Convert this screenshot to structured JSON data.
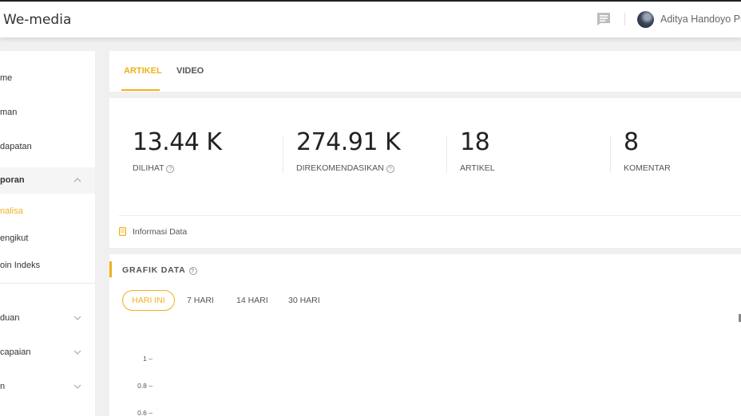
{
  "header": {
    "brand": "We-media",
    "message_icon": "message-icon",
    "user_name": "Aditya Handoyo Pr"
  },
  "sidebar": {
    "items": [
      {
        "label": "me",
        "chevron": null
      },
      {
        "label": "man",
        "chevron": null
      },
      {
        "label": "dapatan",
        "chevron": null
      },
      {
        "label": "poran",
        "chevron": "chevron-up-icon",
        "expanded": true
      },
      {
        "label": "nalisa",
        "chevron": null,
        "current": true
      },
      {
        "label": "engikut",
        "chevron": null
      },
      {
        "label": "oin Indeks",
        "chevron": null
      },
      {
        "label": "duan",
        "chevron": "chevron-down-icon"
      },
      {
        "label": "capaian",
        "chevron": "chevron-down-icon"
      },
      {
        "label": "n",
        "chevron": "chevron-down-icon"
      }
    ]
  },
  "tabs": [
    {
      "label": "ARTIKEL",
      "active": true
    },
    {
      "label": "VIDEO",
      "active": false
    }
  ],
  "stats": [
    {
      "value": "13.44 K",
      "label": "DILIHAT",
      "help": true
    },
    {
      "value": "274.91 K",
      "label": "DIREKOMENDASIKAN",
      "help": true
    },
    {
      "value": "18",
      "label": "ARTIKEL",
      "help": false
    },
    {
      "value": "8",
      "label": "KOMENTAR",
      "help": false
    }
  ],
  "info": {
    "label": "Informasi Data"
  },
  "graph": {
    "title": "GRAFIK DATA",
    "ranges": [
      {
        "label": "HARI INI",
        "active": true
      },
      {
        "label": "7 HARI",
        "active": false
      },
      {
        "label": "14 HARI",
        "active": false
      },
      {
        "label": "30 HARI",
        "active": false
      }
    ],
    "y_ticks": [
      "1 –",
      "0.8 –",
      "0.6 –"
    ]
  },
  "colors": {
    "accent": "#f0b01c",
    "background": "#f0f0f0",
    "card": "#ffffff"
  }
}
